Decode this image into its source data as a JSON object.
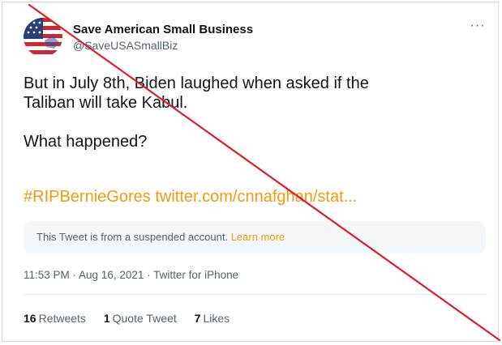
{
  "account": {
    "display_name": "Save American Small Business",
    "handle": "@SaveUSASmallBiz",
    "avatar_icon": "us-flag-avatar"
  },
  "menu": {
    "more_label": "···",
    "more_icon": "more-options-icon"
  },
  "tweet": {
    "line1": "But in July 8th, Biden laughed when asked if the",
    "line2": "Taliban will take Kabul.",
    "line3": "What happened?",
    "hashtag": "#RIPBernieGores",
    "link": "twitter.com/cnnafghan/stat..."
  },
  "notice": {
    "text": "This Tweet is from a suspended account.",
    "learn_more": "Learn more"
  },
  "meta": {
    "text": "11:53 PM · Aug 16, 2021 · Twitter for iPhone"
  },
  "stats": {
    "retweets_count": "16",
    "retweets_label": "Retweets",
    "quotes_count": "1",
    "quotes_label": "Quote Tweet",
    "likes_count": "7",
    "likes_label": "Likes"
  },
  "colors": {
    "link": "#f19a12",
    "strike": "#e01e2a",
    "muted": "#536471"
  }
}
